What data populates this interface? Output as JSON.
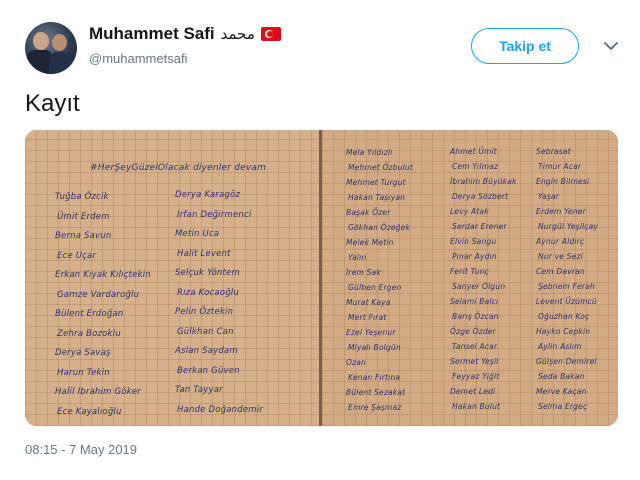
{
  "user": {
    "display_name": "Muhammet Safi",
    "arabic_name": "محمد",
    "flag_icon": "turkey-flag-icon",
    "handle": "@muhammetsafi"
  },
  "follow_button": {
    "label": "Takip et",
    "color": "#1da1f2"
  },
  "tweet": {
    "text": "Kayıt",
    "timestamp": "08:15 - 7 May 2019"
  },
  "media": {
    "left_page": {
      "heading": "#HerŞeyGüzelOlacak diyenler devam",
      "col1": [
        "Tuğba Özcik",
        "Ümit Erdem",
        "Berna Savun",
        "Ece Uçar",
        "Erkan Kıyak Kılıçtekin",
        "Gamze Vardaroğlu",
        "Bülent Erdoğan",
        "Zehra Bozoklu",
        "Derya Savaş",
        "Harun Tekin",
        "Halil Ibrahim Göker",
        "Ece Kayalıoğlu"
      ],
      "col2": [
        "Derya Karagöz",
        "Irfan Değirmenci",
        "Metin Uca",
        "Halit Levent",
        "Selçuk Yöntem",
        "Rıza Kocaoğlu",
        "Pelin Öztekin",
        "Gülkhan Can",
        "Aslan Saydam",
        "Berkan Güven",
        "Tan Tayyar",
        "Hande Doğandemir"
      ]
    },
    "right_page": {
      "col1": [
        "Mela Yıldızlı",
        "Mehmet Özbulut",
        "Mehmet Turgut",
        "Hakan Taşıyan",
        "Başak Özer",
        "Gökhan Özeğek",
        "Melek Metin",
        "Yalın",
        "İrem Sak",
        "Gülben Ergen",
        "Murat Kaya",
        "Mert Fırat",
        "Ezel Yeşenur",
        "Miyalı Bolgün",
        "Ozan",
        "Kenan Fırtına",
        "Bülent Sezakat",
        "Emre Şaşmaz"
      ],
      "col2": [
        "Ahmet Ümit",
        "Cem Yılmaz",
        "İbrahim Büyükak",
        "Derya Sözbert",
        "Levy Atak",
        "Serdar Erener",
        "Elvin Sangu",
        "Pınar Aydın",
        "Ferit Tunç",
        "Sanyer Olgun",
        "Selami Balcı",
        "Barış Özcan",
        "Özge Özder",
        "Tansel Acar",
        "Sermet Yeşil",
        "Feyyaz Yiğit",
        "Demet Ledi",
        "Hakan Bulut"
      ],
      "col3": [
        "Sebrasat",
        "Timur Acar",
        "Engin Bilmesi",
        "Yaşar",
        "Erdem Yener",
        "Nurgül Yeşilçay",
        "Aynur Aldırç",
        "Nur ve Sezi",
        "Cem Davran",
        "Şebnem Ferah",
        "Levent Üzümcü",
        "Oğuzhan Koç",
        "Hayko Cepkin",
        "Aylin Aslım",
        "Gülşen Demirel",
        "Seda Bakan",
        "Merve Kaçan",
        "Selma Ergeç"
      ]
    }
  }
}
